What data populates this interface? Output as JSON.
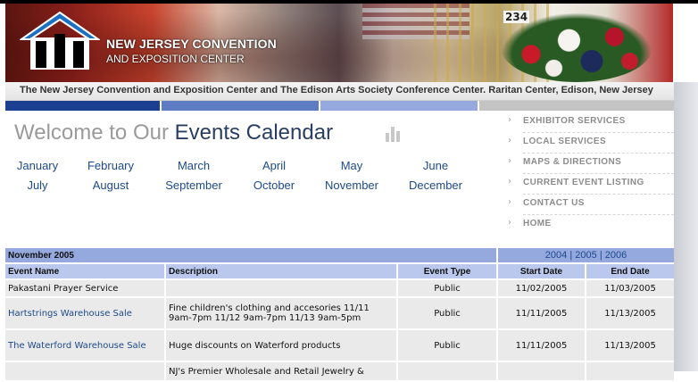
{
  "header": {
    "logo_line1": "NEW JERSEY CONVENTION",
    "logo_line2": "AND EXPOSITION CENTER",
    "table_number": "234",
    "caption": "The New Jersey Convention and Exposition Center and The Edison Arts Society Conference Center.   Raritan Center, Edison, New Jersey"
  },
  "welcome": {
    "part1": "Welcome to Our ",
    "part2": "Events Calendar"
  },
  "months": [
    "January",
    "February",
    "March",
    "April",
    "May",
    "June",
    "July",
    "August",
    "September",
    "October",
    "November",
    "December"
  ],
  "sidenav": [
    "EXHIBITOR SERVICES",
    "LOCAL SERVICES",
    "MAPS & DIRECTIONS",
    "CURRENT EVENT LISTING",
    "CONTACT US",
    "HOME"
  ],
  "table": {
    "month_label": "November 2005",
    "years": [
      "2004",
      "2005",
      "2006"
    ],
    "year_separator": "|",
    "columns": [
      "Event Name",
      "Description",
      "Event Type",
      "Start Date",
      "End Date"
    ],
    "rows": [
      {
        "name": "Pakastani Prayer Service",
        "link": false,
        "description": "",
        "type": "Public",
        "start": "11/02/2005",
        "end": "11/03/2005"
      },
      {
        "name": "Hartstrings Warehouse Sale",
        "link": true,
        "description": "Fine children's clothing and accesories 11/11 9am-7pm 11/12 9am-7pm 11/13 9am-5pm",
        "type": "Public",
        "start": "11/11/2005",
        "end": "11/13/2005"
      },
      {
        "name": "The Waterford Warehouse Sale",
        "link": true,
        "description": "Huge discounts on Waterford products",
        "type": "Public",
        "start": "11/11/2005",
        "end": "11/13/2005"
      },
      {
        "name": "",
        "link": false,
        "description": "NJ's Premier Wholesale and Retail Jewelry &",
        "type": "",
        "start": "",
        "end": ""
      }
    ]
  },
  "colors": {
    "nav_dark": "#1d3f91",
    "nav_mid": "#5d7cc4",
    "nav_light": "#95a9de",
    "nav_gray": "#c4c4c4",
    "link": "#1d4a8a"
  }
}
